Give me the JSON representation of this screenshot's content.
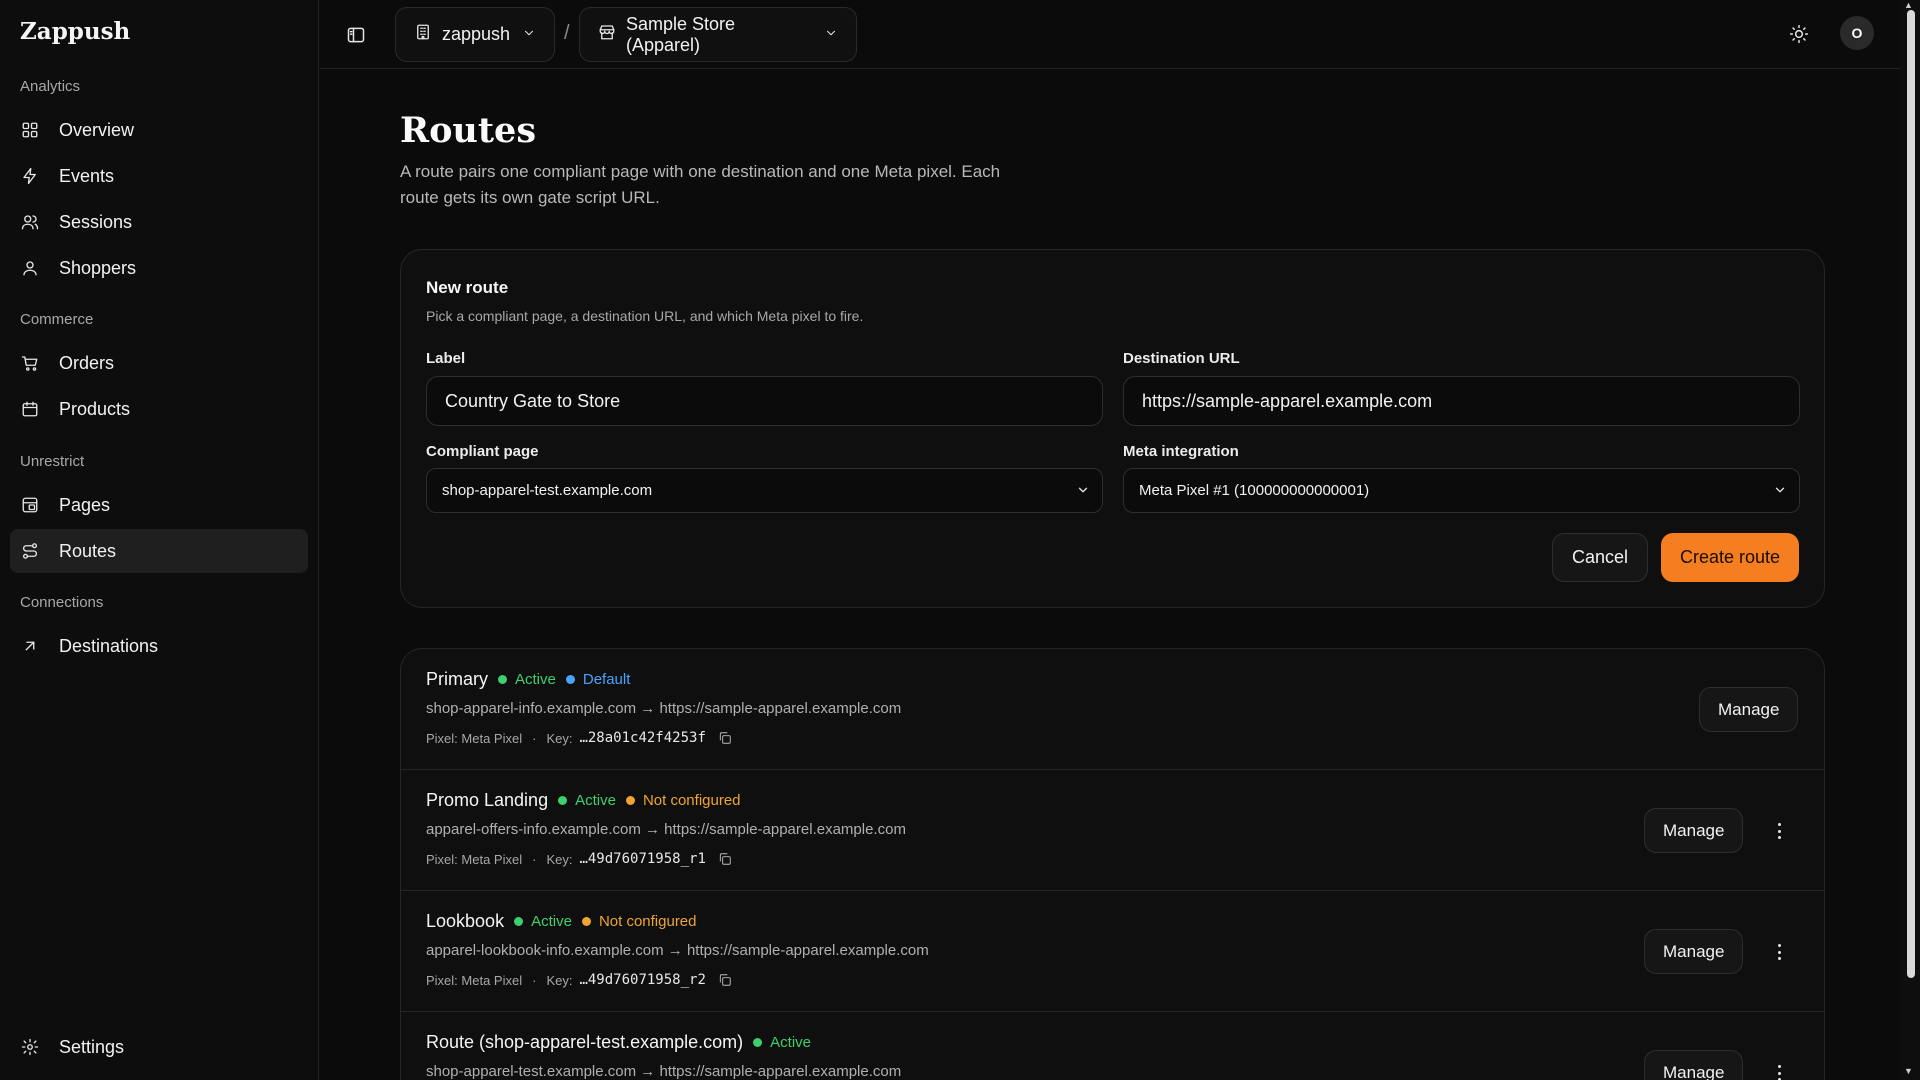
{
  "app": {
    "name": "Zappush"
  },
  "sidebar": {
    "sections": [
      {
        "label": "Analytics",
        "items": [
          {
            "label": "Overview",
            "icon": "grid-icon"
          },
          {
            "label": "Events",
            "icon": "bolt-icon"
          },
          {
            "label": "Sessions",
            "icon": "users-icon"
          },
          {
            "label": "Shoppers",
            "icon": "user-icon"
          }
        ]
      },
      {
        "label": "Commerce",
        "items": [
          {
            "label": "Orders",
            "icon": "cart-icon"
          },
          {
            "label": "Products",
            "icon": "box-icon"
          }
        ]
      },
      {
        "label": "Unrestrict",
        "items": [
          {
            "label": "Pages",
            "icon": "pages-icon"
          },
          {
            "label": "Routes",
            "icon": "route-icon",
            "active": true
          }
        ]
      },
      {
        "label": "Connections",
        "items": [
          {
            "label": "Destinations",
            "icon": "arrow-up-right-icon"
          }
        ]
      }
    ],
    "settings": {
      "label": "Settings",
      "icon": "gear-icon"
    }
  },
  "topbar": {
    "workspace": "zappush",
    "separator": "/",
    "store": "Sample Store (Apparel)",
    "avatar_initial": "O"
  },
  "page": {
    "title": "Routes",
    "description": "A route pairs one compliant page with one destination and one Meta pixel. Each route gets its own gate script URL."
  },
  "form": {
    "title": "New route",
    "subtitle": "Pick a compliant page, a destination URL, and which Meta pixel to fire.",
    "label_field": {
      "label": "Label",
      "value": "Country Gate to Store"
    },
    "destination_field": {
      "label": "Destination URL",
      "value": "https://sample-apparel.example.com"
    },
    "compliant_page": {
      "label": "Compliant page",
      "value": "shop-apparel-test.example.com"
    },
    "meta_integration": {
      "label": "Meta integration",
      "value": "Meta Pixel #1 (100000000000001)"
    },
    "cancel_label": "Cancel",
    "create_label": "Create route"
  },
  "routes": [
    {
      "name": "Primary",
      "badges": [
        {
          "text": "Active",
          "color": "#3ecf6e"
        },
        {
          "text": "Default",
          "color": "#4aa3ff"
        }
      ],
      "path": "shop-apparel-info.example.com → https://sample-apparel.example.com",
      "pixel": "Pixel: Meta Pixel",
      "key_label": "Key:",
      "key": "…28a01c42f4253f",
      "manage_label": "Manage",
      "has_menu": false
    },
    {
      "name": "Promo Landing",
      "badges": [
        {
          "text": "Active",
          "color": "#3ecf6e"
        },
        {
          "text": "Not configured",
          "color": "#f0a431"
        }
      ],
      "path": "apparel-offers-info.example.com → https://sample-apparel.example.com",
      "pixel": "Pixel: Meta Pixel",
      "key_label": "Key:",
      "key": "…49d76071958_r1",
      "manage_label": "Manage",
      "has_menu": true
    },
    {
      "name": "Lookbook",
      "badges": [
        {
          "text": "Active",
          "color": "#3ecf6e"
        },
        {
          "text": "Not configured",
          "color": "#f0a431"
        }
      ],
      "path": "apparel-lookbook-info.example.com → https://sample-apparel.example.com",
      "pixel": "Pixel: Meta Pixel",
      "key_label": "Key:",
      "key": "…49d76071958_r2",
      "manage_label": "Manage",
      "has_menu": true
    },
    {
      "name": "Route (shop-apparel-test.example.com)",
      "badges": [
        {
          "text": "Active",
          "color": "#3ecf6e"
        }
      ],
      "path": "shop-apparel-test.example.com → https://sample-apparel.example.com",
      "pixel": "",
      "key_label": "",
      "key": "",
      "manage_label": "Manage",
      "has_menu": true
    }
  ],
  "colors": {
    "accent": "#f47e20",
    "active": "#3ecf6e",
    "default": "#4aa3ff",
    "warning": "#f0a431"
  }
}
